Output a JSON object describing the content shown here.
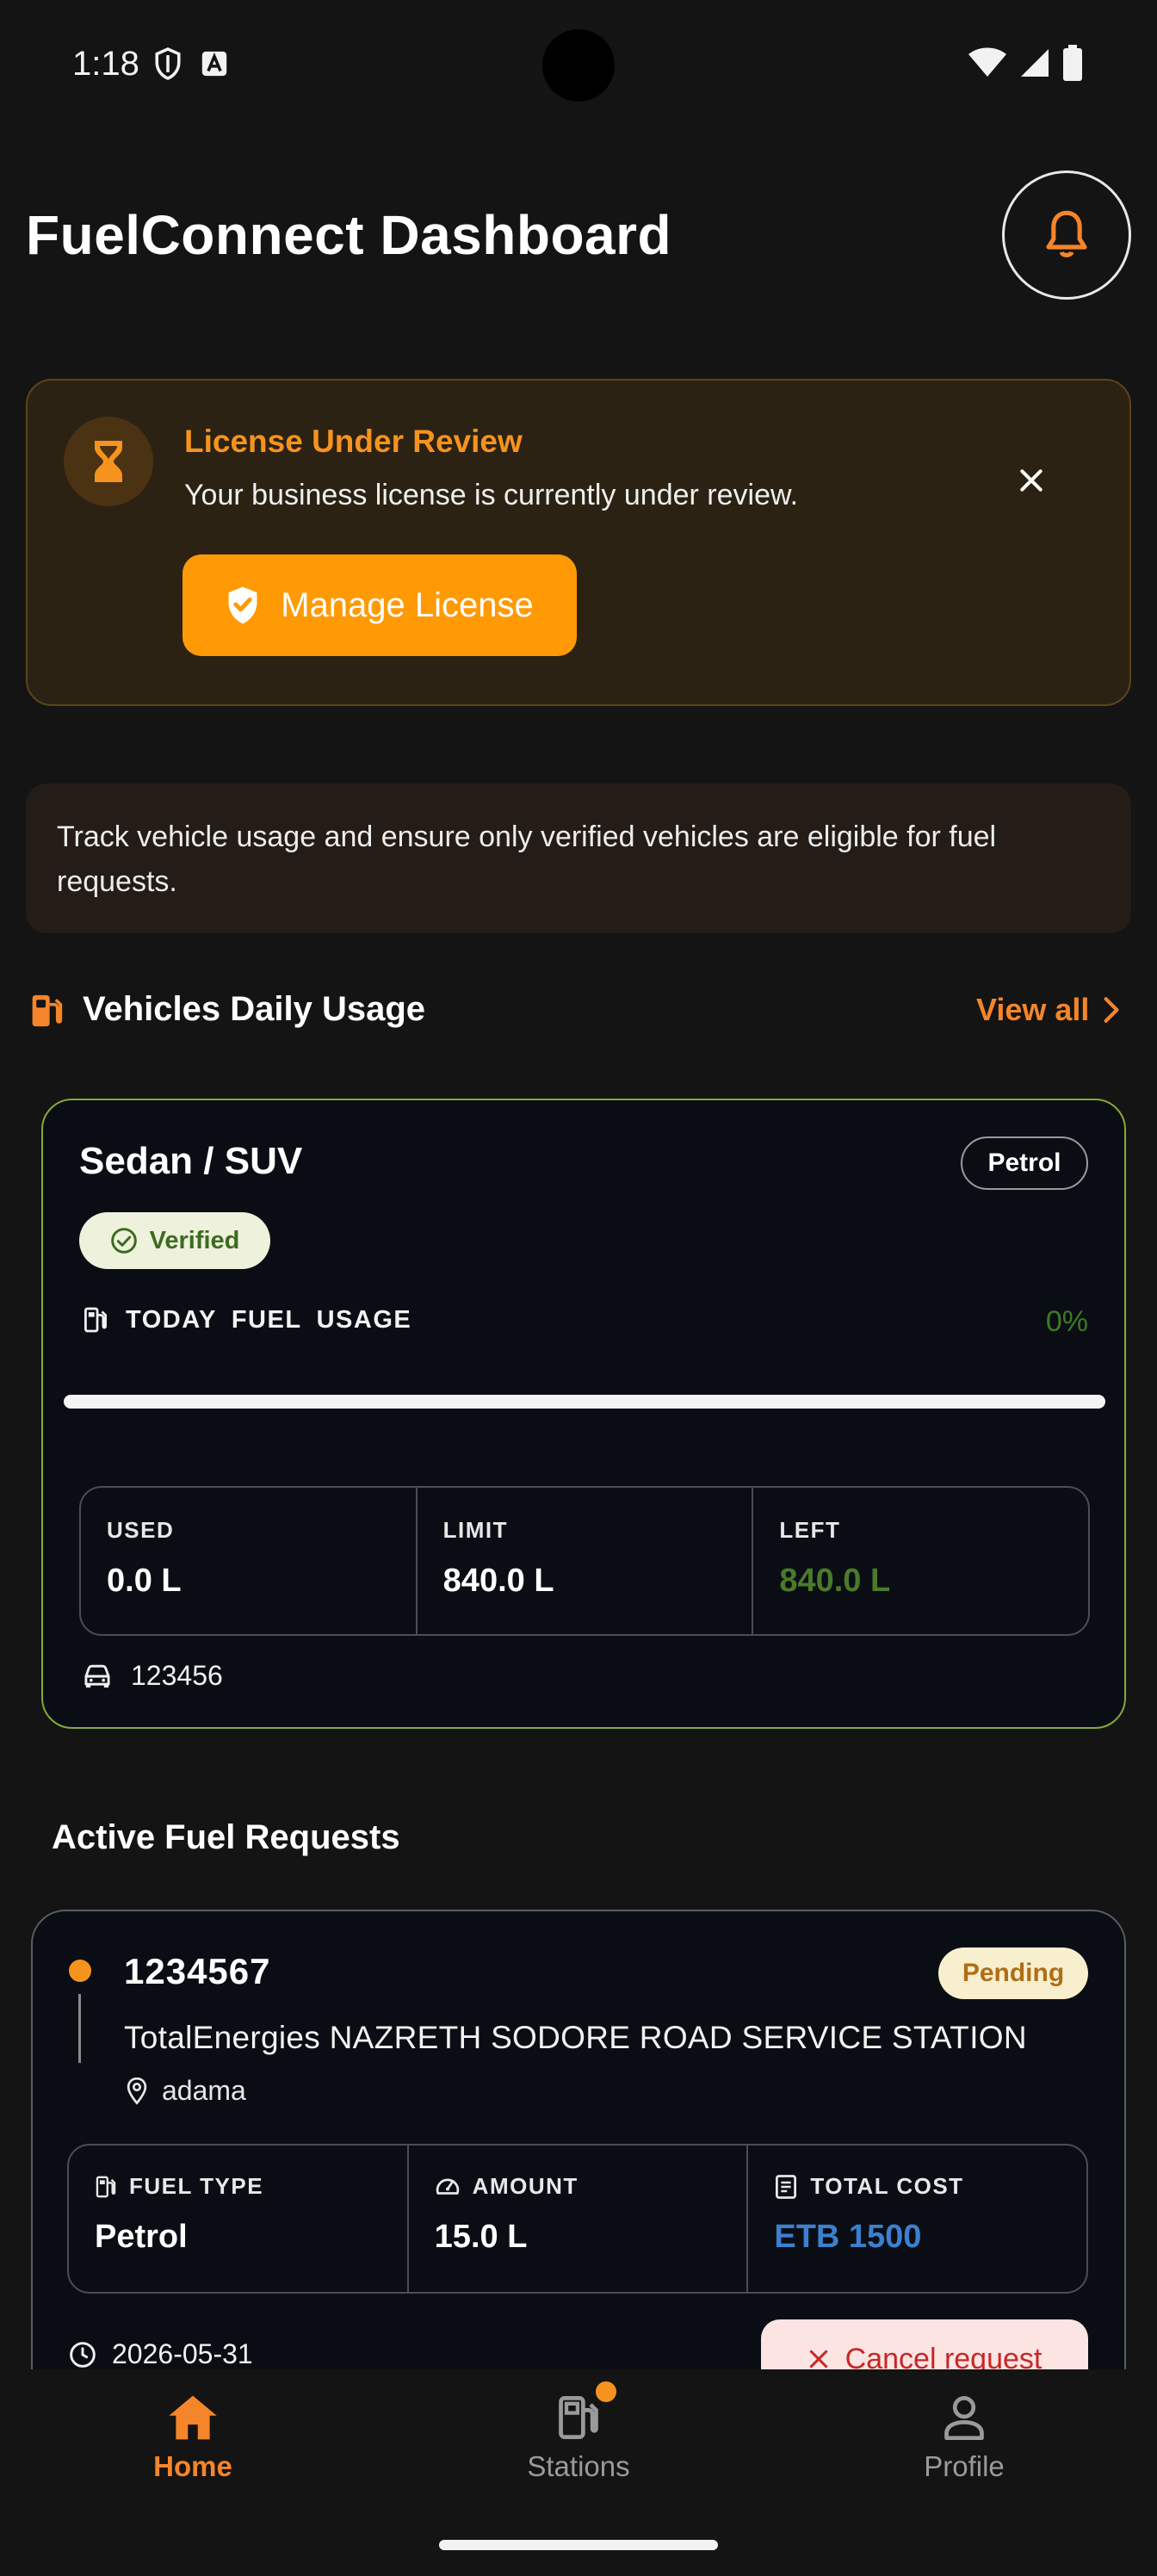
{
  "status_bar": {
    "time": "1:18"
  },
  "header": {
    "title": "FuelConnect Dashboard",
    "bell_icon": "bell-icon"
  },
  "license_banner": {
    "title": "License Under Review",
    "message": "Your business license is currently under review.",
    "button_label": "Manage License",
    "accent_color": "#f6931e"
  },
  "info": {
    "text": "Track vehicle usage and ensure only verified vehicles are eligible for fuel requests."
  },
  "vehicles_section": {
    "title": "Vehicles Daily Usage",
    "view_all": "View all"
  },
  "vehicle_card": {
    "name": "Sedan / SUV",
    "fuel_type": "Petrol",
    "verified_label": "Verified",
    "usage_label": "TODAY  FUEL USAGE",
    "usage_percent": "0%",
    "usage_fraction": 0,
    "stats": [
      {
        "label": "USED",
        "value": "0.0 L"
      },
      {
        "label": "LIMIT",
        "value": "840.0 L"
      },
      {
        "label": "LEFT",
        "value": "840.0 L"
      }
    ],
    "plate": "123456"
  },
  "requests_section": {
    "title": "Active Fuel Requests"
  },
  "request_card": {
    "id": "1234567",
    "status": "Pending",
    "station": "TotalEnergies NAZRETH SODORE ROAD SERVICE STATION",
    "location": "adama",
    "stats": [
      {
        "label": "FUEL TYPE",
        "value": "Petrol"
      },
      {
        "label": "AMOUNT",
        "value": "15.0 L"
      },
      {
        "label": "TOTAL COST",
        "value": "ETB 1500"
      }
    ],
    "date": "2026-05-31",
    "cancel_label": "Cancel request"
  },
  "bottom_nav": {
    "items": [
      {
        "label": "Home",
        "icon": "home-icon",
        "active": true
      },
      {
        "label": "Stations",
        "icon": "fuel-station-icon",
        "active": false
      },
      {
        "label": "Profile",
        "icon": "person-icon",
        "active": false
      }
    ]
  }
}
